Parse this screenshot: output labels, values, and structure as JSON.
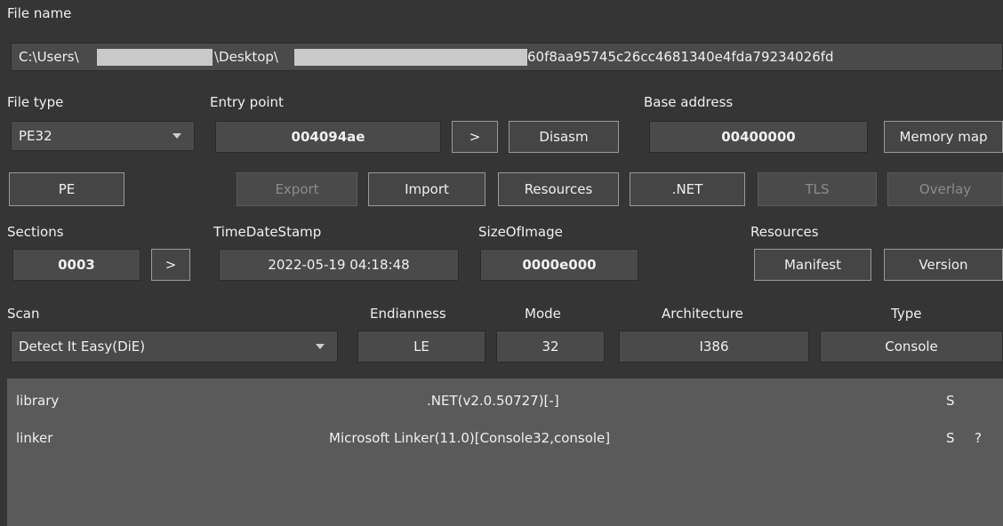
{
  "file": {
    "label": "File name",
    "path_start": "C:\\Users\\",
    "path_mid": "\\Desktop\\",
    "path_end": "60f8aa95745c26cc4681340e4fda79234026fd"
  },
  "file_type": {
    "label": "File type",
    "value": "PE32"
  },
  "entry_point": {
    "label": "Entry point",
    "value": "004094ae",
    "go": ">",
    "disasm": "Disasm"
  },
  "base_address": {
    "label": "Base address",
    "value": "00400000",
    "memory_map": "Memory map"
  },
  "buttons": {
    "pe": "PE",
    "export": "Export",
    "import": "Import",
    "resources": "Resources",
    "net": ".NET",
    "tls": "TLS",
    "overlay": "Overlay"
  },
  "sections": {
    "label": "Sections",
    "value": "0003",
    "go": ">"
  },
  "timedatestamp": {
    "label": "TimeDateStamp",
    "value": "2022-05-19 04:18:48"
  },
  "size_of_image": {
    "label": "SizeOfImage",
    "value": "0000e000"
  },
  "resources": {
    "label": "Resources",
    "manifest": "Manifest",
    "version": "Version"
  },
  "scan": {
    "label": "Scan",
    "value": "Detect It Easy(DiE)"
  },
  "endianness": {
    "label": "Endianness",
    "value": "LE"
  },
  "mode": {
    "label": "Mode",
    "value": "32"
  },
  "architecture": {
    "label": "Architecture",
    "value": "I386"
  },
  "type": {
    "label": "Type",
    "value": "Console"
  },
  "results": [
    {
      "name": "library",
      "value": ".NET(v2.0.50727)[-]",
      "s": "S",
      "q": ""
    },
    {
      "name": "linker",
      "value": "Microsoft Linker(11.0)[Console32,console]",
      "s": "S",
      "q": "?"
    }
  ],
  "colors": {
    "background": "#353535",
    "field": "#4a4a4a",
    "results_bg": "#5a5a5a"
  }
}
